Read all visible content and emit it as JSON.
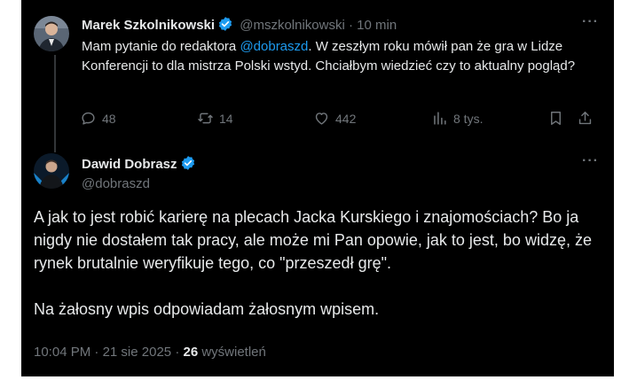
{
  "reply_to": {
    "author_name": "Marek Szkolnikowski",
    "handle": "@mszkolnikowski",
    "separator": "·",
    "time": "10 min",
    "text_before": "Mam pytanie do redaktora ",
    "mention": "@dobraszd",
    "text_after": ". W zeszłym roku mówił pan że gra w Lidze Konferencji to dla mistrza Polski wstyd. Chciałbym wiedzieć czy to aktualny pogląd?",
    "stats": {
      "replies": "48",
      "reposts": "14",
      "likes": "442",
      "views": "8 tys."
    }
  },
  "tweet": {
    "author_name": "Dawid Dobrasz",
    "handle": "@dobraszd",
    "paragraph1": "A jak to jest robić karierę na plecach Jacka Kurskiego i znajomościach? Bo ja nigdy nie dostałem tak pracy, ale może mi Pan opowie, jak to jest, bo widzę, że rynek brutalnie weryfikuje tego, co \"przeszedł grę\".",
    "paragraph2": "Na żałosny wpis odpowiadam żałosnym wpisem.",
    "time": "10:04 PM",
    "dot1": "·",
    "date": "21 sie 2025",
    "dot2": "·",
    "views_count": "26",
    "views_label": "wyświetleń"
  },
  "colors": {
    "accent": "#1d9bf0",
    "background": "#000000",
    "muted": "#71767b",
    "text": "#e7e9ea"
  },
  "icons": [
    "verified-badge-icon",
    "more-icon",
    "reply-icon",
    "repost-icon",
    "like-icon",
    "views-icon",
    "bookmark-icon",
    "share-icon"
  ]
}
